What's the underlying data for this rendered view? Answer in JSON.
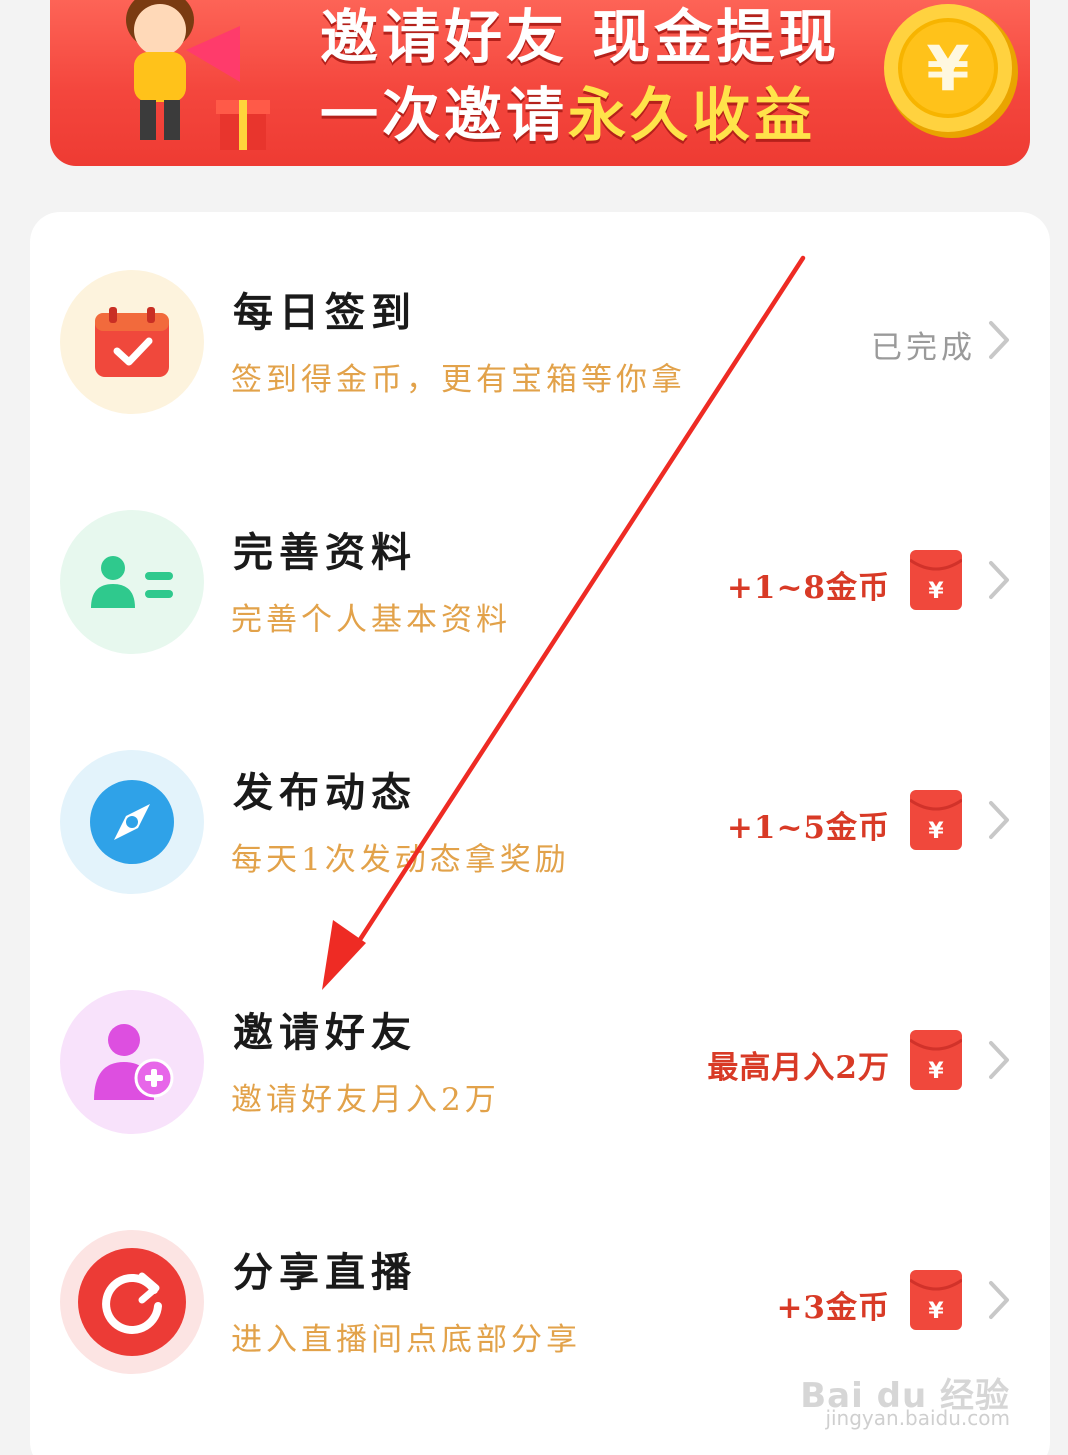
{
  "banner": {
    "line1": "邀请好友 现金提现",
    "line2_part1": "一次邀请",
    "line2_part2": "永久收益",
    "coin_symbol": "¥"
  },
  "tasks": [
    {
      "icon": "calendar-check-icon",
      "title": "每日签到",
      "desc": "签到得金币，更有宝箱等你拿",
      "status": "已完成",
      "reward": "",
      "icon_bg": "#fdf3dd",
      "icon_color": "#f0483c"
    },
    {
      "icon": "profile-card-icon",
      "title": "完善资料",
      "desc": "完善个人基本资料",
      "status": "",
      "reward": "+1~8金币",
      "icon_bg": "#e7f8ee",
      "icon_color": "#2fc98d"
    },
    {
      "icon": "compass-icon",
      "title": "发布动态",
      "desc": "每天1次发动态拿奖励",
      "status": "",
      "reward": "+1~5金币",
      "icon_bg": "#e3f3fb",
      "icon_color": "#2fa2e8"
    },
    {
      "icon": "add-friend-icon",
      "title": "邀请好友",
      "desc": "邀请好友月入2万",
      "status": "",
      "reward": "最高月入2万",
      "icon_bg": "#f8e2fb",
      "icon_color": "#dd4fe0"
    },
    {
      "icon": "share-refresh-icon",
      "title": "分享直播",
      "desc": "进入直播间点底部分享",
      "status": "",
      "reward": "+3金币",
      "icon_bg": "#fce4e3",
      "icon_color": "#ec3b36"
    }
  ],
  "envelope_symbol": "¥",
  "watermark": {
    "brand": "Bai du 经验",
    "url": "jingyan.baidu.com"
  },
  "colors": {
    "accent_red": "#f0483c",
    "reward_red": "#d83a26",
    "desc_orange": "#e2a24a",
    "status_gray": "#9a9a9a"
  }
}
